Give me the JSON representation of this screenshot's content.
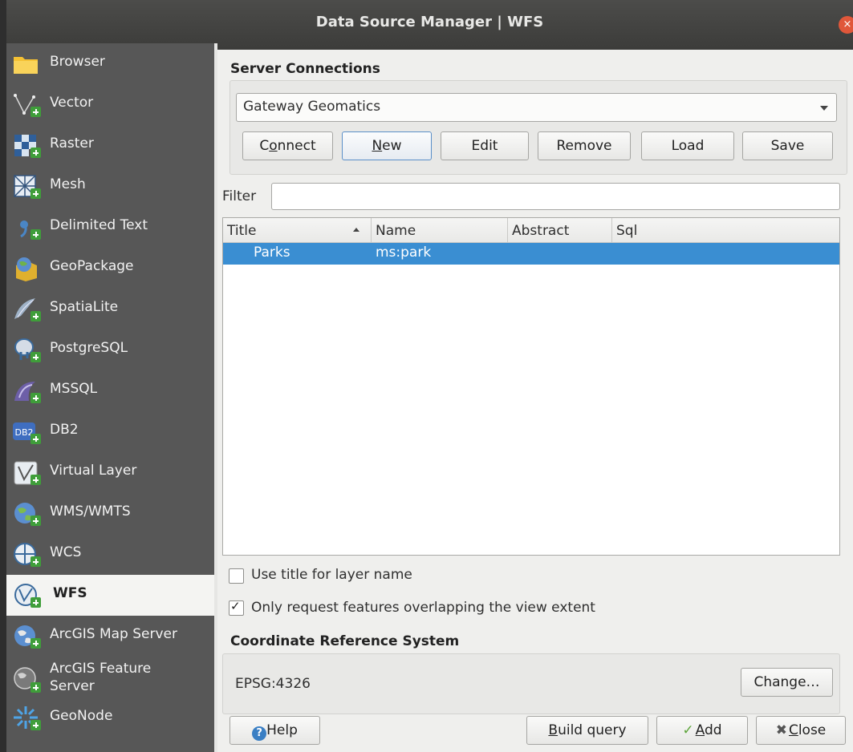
{
  "window": {
    "title": "Data Source Manager | WFS",
    "close_symbol": "×"
  },
  "sidebar": {
    "items": [
      {
        "label": "Browser",
        "icon": "folder-icon"
      },
      {
        "label": "Vector",
        "icon": "vector-icon"
      },
      {
        "label": "Raster",
        "icon": "raster-icon"
      },
      {
        "label": "Mesh",
        "icon": "mesh-icon"
      },
      {
        "label": "Delimited Text",
        "icon": "delimited-text-icon"
      },
      {
        "label": "GeoPackage",
        "icon": "geopackage-icon"
      },
      {
        "label": "SpatiaLite",
        "icon": "spatialite-icon"
      },
      {
        "label": "PostgreSQL",
        "icon": "postgresql-icon"
      },
      {
        "label": "MSSQL",
        "icon": "mssql-icon"
      },
      {
        "label": "DB2",
        "icon": "db2-icon",
        "badge": "DB2"
      },
      {
        "label": "Virtual Layer",
        "icon": "virtual-layer-icon"
      },
      {
        "label": "WMS/WMTS",
        "icon": "wms-icon"
      },
      {
        "label": "WCS",
        "icon": "wcs-icon"
      },
      {
        "label": "WFS",
        "icon": "wfs-icon",
        "active": true
      },
      {
        "label": "ArcGIS Map Server",
        "icon": "arcgis-map-server-icon"
      },
      {
        "label_line1": "ArcGIS Feature",
        "label_line2": "Server",
        "icon": "arcgis-feature-server-icon"
      },
      {
        "label": "GeoNode",
        "icon": "geonode-icon"
      }
    ]
  },
  "server_connections": {
    "heading": "Server Connections",
    "selected": "Gateway Geomatics",
    "buttons": {
      "connect_pre": "C",
      "connect_u": "o",
      "connect_post": "nnect",
      "new_u": "N",
      "new_post": "ew",
      "edit": "Edit",
      "remove": "Remove",
      "load": "Load",
      "save": "Save"
    }
  },
  "filter": {
    "label": "Filter",
    "value": ""
  },
  "table": {
    "columns": [
      "Title",
      "Name",
      "Abstract",
      "Sql"
    ],
    "rows": [
      {
        "title": "Parks",
        "name": "ms:park",
        "abstract": "",
        "sql": ""
      }
    ]
  },
  "options": {
    "use_title": {
      "label": "Use title for layer name",
      "checked": false
    },
    "only_request": {
      "label": "Only request features overlapping the view extent",
      "checked": true,
      "mark": "✓"
    }
  },
  "crs": {
    "heading": "Coordinate Reference System",
    "value": "EPSG:4326",
    "change_label": "Change…"
  },
  "footer": {
    "help_icon_glyph": "?",
    "help_label": "Help",
    "build_u": "B",
    "build_post": "uild query",
    "add_icon_glyph": "✓",
    "add_u": "A",
    "add_post": "dd",
    "close_icon_glyph": "✖",
    "close_u": "C",
    "close_post": "lose"
  }
}
